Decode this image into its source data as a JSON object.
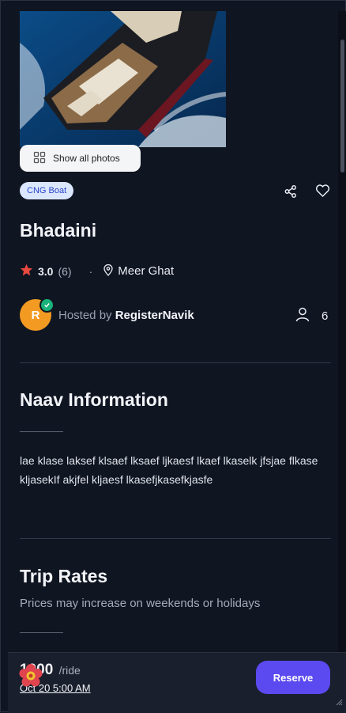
{
  "gallery": {
    "show_all_label": "Show all photos"
  },
  "boat": {
    "badge": "CNG Boat",
    "name": "Bhadaini",
    "rating": "3.0",
    "reviews": "(6)",
    "separator": "·",
    "location": "Meer Ghat"
  },
  "host": {
    "initial": "R",
    "prefix": "Hosted by ",
    "name": "RegisterNavik",
    "guests": "6"
  },
  "info": {
    "heading": "Naav Information",
    "description": "lae klase laksef klsaef lksaef ljkaesf lkaef lkaselk jfsjae flkase kljasekIf akjfel kljaesf lkasefjkasefkjasfe"
  },
  "rates": {
    "heading": "Trip Rates",
    "note": "Prices may increase on weekends or holidays"
  },
  "footer": {
    "price": "1000",
    "unit": "/ride",
    "date": "Oct 20 5:00 AM",
    "reserve_label": "Reserve"
  },
  "colors": {
    "accent": "#5b4af0",
    "star": "#e8483e",
    "verified": "#18b27a",
    "avatar": "#f29a22"
  },
  "icons": [
    "grid-icon",
    "share-icon",
    "heart-icon",
    "star-icon",
    "map-pin-icon",
    "verified-check-icon",
    "user-icon",
    "flower-icon",
    "resize-grip-icon"
  ]
}
